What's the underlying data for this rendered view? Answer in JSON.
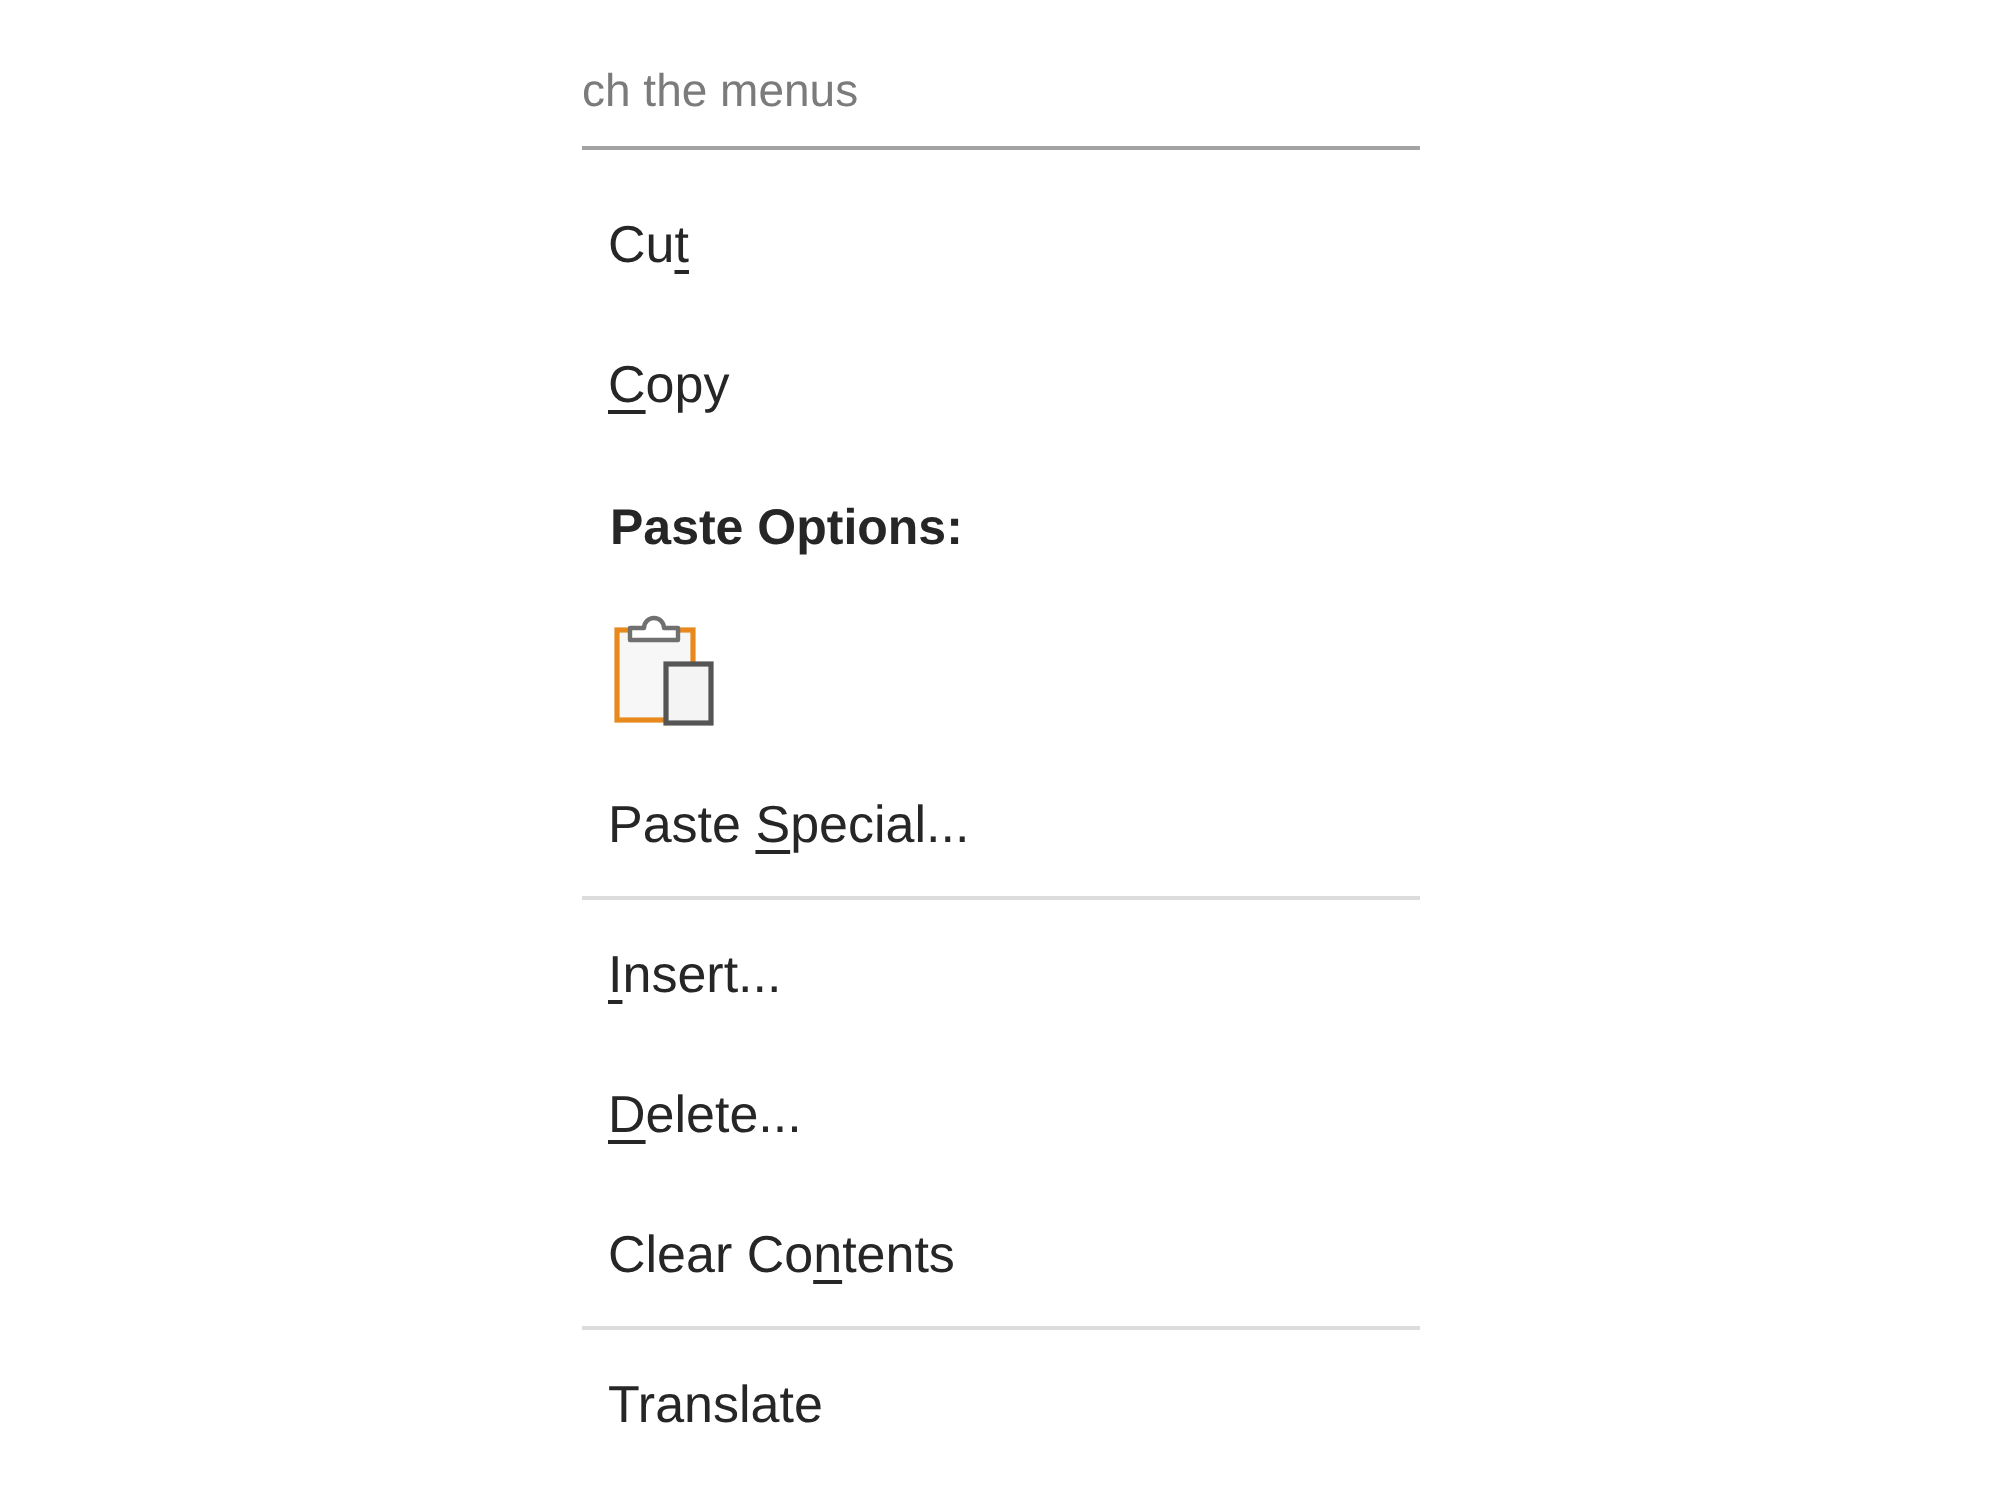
{
  "search": {
    "placeholder": "ch the menus"
  },
  "menu": [
    {
      "kind": "item",
      "parts": [
        {
          "text": "Cu",
          "underlined": false
        },
        {
          "text": "t",
          "underlined": true
        }
      ]
    },
    {
      "kind": "item",
      "parts": [
        {
          "text": "C",
          "underlined": true
        },
        {
          "text": "opy",
          "underlined": false
        }
      ]
    },
    {
      "kind": "heading",
      "label": "Paste Options:"
    },
    {
      "kind": "paste_icons"
    },
    {
      "kind": "item",
      "parts": [
        {
          "text": "Paste ",
          "underlined": false
        },
        {
          "text": "S",
          "underlined": true
        },
        {
          "text": "pecial...",
          "underlined": false
        }
      ]
    },
    {
      "kind": "separator"
    },
    {
      "kind": "item",
      "parts": [
        {
          "text": "I",
          "underlined": true
        },
        {
          "text": "nsert...",
          "underlined": false
        }
      ]
    },
    {
      "kind": "item",
      "parts": [
        {
          "text": "D",
          "underlined": true
        },
        {
          "text": "elete...",
          "underlined": false
        }
      ]
    },
    {
      "kind": "item",
      "parts": [
        {
          "text": "Clear Co",
          "underlined": false
        },
        {
          "text": "n",
          "underlined": true
        },
        {
          "text": "tents",
          "underlined": false
        }
      ]
    },
    {
      "kind": "separator"
    },
    {
      "kind": "item",
      "parts": [
        {
          "text": "Translate",
          "underlined": false
        }
      ]
    }
  ]
}
